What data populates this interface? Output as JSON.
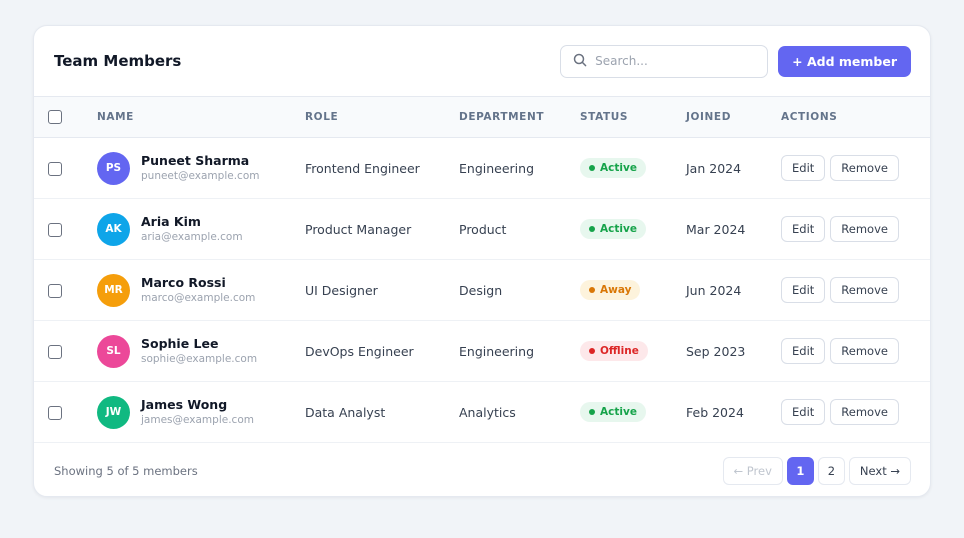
{
  "header": {
    "title": "Team Members",
    "search_placeholder": "Search...",
    "add_button": "+ Add member"
  },
  "table": {
    "columns": [
      "NAME",
      "ROLE",
      "DEPARTMENT",
      "STATUS",
      "JOINED",
      "ACTIONS"
    ],
    "rows": [
      {
        "initials": "PS",
        "avatar_color": "#6366f1",
        "name": "Puneet Sharma",
        "email": "puneet@example.com",
        "role": "Frontend Engineer",
        "department": "Engineering",
        "status": "Active",
        "status_kind": "active",
        "joined": "Jan 2024",
        "edit": "Edit",
        "remove": "Remove"
      },
      {
        "initials": "AK",
        "avatar_color": "#0ea5e9",
        "name": "Aria Kim",
        "email": "aria@example.com",
        "role": "Product Manager",
        "department": "Product",
        "status": "Active",
        "status_kind": "active",
        "joined": "Mar 2024",
        "edit": "Edit",
        "remove": "Remove"
      },
      {
        "initials": "MR",
        "avatar_color": "#f59e0b",
        "name": "Marco Rossi",
        "email": "marco@example.com",
        "role": "UI Designer",
        "department": "Design",
        "status": "Away",
        "status_kind": "away",
        "joined": "Jun 2024",
        "edit": "Edit",
        "remove": "Remove"
      },
      {
        "initials": "SL",
        "avatar_color": "#ec4899",
        "name": "Sophie Lee",
        "email": "sophie@example.com",
        "role": "DevOps Engineer",
        "department": "Engineering",
        "status": "Offline",
        "status_kind": "offline",
        "joined": "Sep 2023",
        "edit": "Edit",
        "remove": "Remove"
      },
      {
        "initials": "JW",
        "avatar_color": "#10b981",
        "name": "James Wong",
        "email": "james@example.com",
        "role": "Data Analyst",
        "department": "Analytics",
        "status": "Active",
        "status_kind": "active",
        "joined": "Feb 2024",
        "edit": "Edit",
        "remove": "Remove"
      }
    ]
  },
  "status_colors": {
    "active": {
      "bg": "#e7f7ee",
      "fg": "#16a34a"
    },
    "away": {
      "bg": "#fdf3dc",
      "fg": "#d97706"
    },
    "offline": {
      "bg": "#fde8ea",
      "fg": "#dc2626"
    }
  },
  "footer": {
    "summary": "Showing 5 of 5 members",
    "prev": "← Prev",
    "pages": [
      "1",
      "2"
    ],
    "current_page": "1",
    "next": "Next →"
  },
  "colors": {
    "accent": "#6366f1",
    "background": "#f1f4f8"
  },
  "icons": {
    "search": "search-icon"
  }
}
